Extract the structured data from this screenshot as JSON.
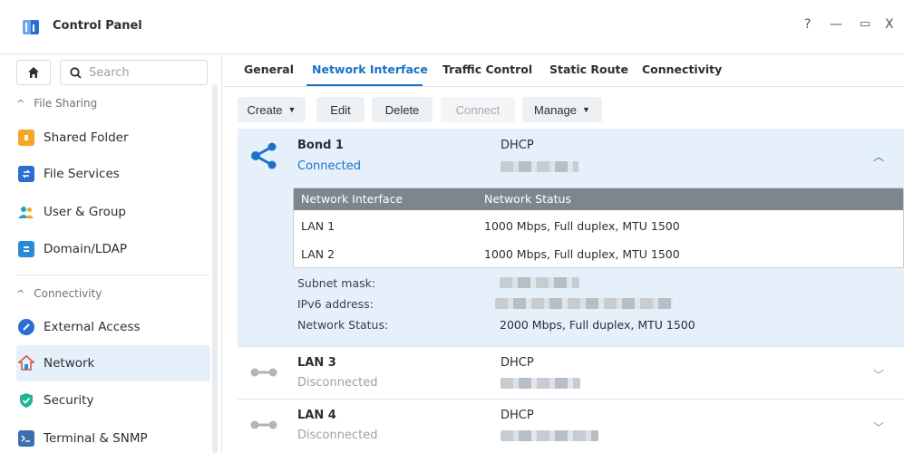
{
  "window": {
    "title": "Control Panel",
    "controls": {
      "help": "?",
      "minimize": "—",
      "maximize": "▭",
      "close": "X"
    }
  },
  "sidebar": {
    "search_placeholder": "Search",
    "groups": [
      {
        "label": "File Sharing"
      },
      {
        "label": "Connectivity"
      }
    ],
    "items": [
      {
        "label": "Shared Folder",
        "icon": "folder-icon",
        "color": "#f5a623"
      },
      {
        "label": "File Services",
        "icon": "file-services-icon",
        "color": "#2a6fd0"
      },
      {
        "label": "User & Group",
        "icon": "user-group-icon",
        "color": "#1aa6c9"
      },
      {
        "label": "Domain/LDAP",
        "icon": "domain-icon",
        "color": "#2a8ad8"
      },
      {
        "label": "External Access",
        "icon": "external-access-icon",
        "color": "#2a6fd0"
      },
      {
        "label": "Network",
        "icon": "network-house-icon",
        "color": "#e0543a",
        "selected": true
      },
      {
        "label": "Security",
        "icon": "shield-check-icon",
        "color": "#1fb58f"
      },
      {
        "label": "Terminal & SNMP",
        "icon": "terminal-icon",
        "color": "#3a6fb0"
      }
    ]
  },
  "tabs": [
    {
      "label": "General"
    },
    {
      "label": "Network Interface",
      "active": true
    },
    {
      "label": "Traffic Control"
    },
    {
      "label": "Static Route"
    },
    {
      "label": "Connectivity"
    }
  ],
  "toolbar": {
    "create": "Create",
    "edit": "Edit",
    "delete": "Delete",
    "connect": "Connect",
    "manage": "Manage"
  },
  "interfaces": [
    {
      "name": "Bond 1",
      "status": "Connected",
      "mode": "DHCP",
      "expanded": true,
      "members_header": {
        "interface": "Network Interface",
        "status": "Network Status"
      },
      "members": [
        {
          "interface": "LAN 1",
          "status": "1000 Mbps, Full duplex, MTU 1500"
        },
        {
          "interface": "LAN 2",
          "status": "1000 Mbps, Full duplex, MTU 1500"
        }
      ],
      "details": [
        {
          "label": "Subnet mask:"
        },
        {
          "label": "IPv6 address:"
        },
        {
          "label": "Network Status:",
          "value": "2000 Mbps, Full duplex, MTU 1500"
        }
      ]
    },
    {
      "name": "LAN 3",
      "status": "Disconnected",
      "mode": "DHCP"
    },
    {
      "name": "LAN 4",
      "status": "Disconnected",
      "mode": "DHCP"
    }
  ],
  "colors": {
    "accent": "#1a73c9",
    "selected_bg": "#e6f0fb",
    "table_header": "#7d858d"
  }
}
